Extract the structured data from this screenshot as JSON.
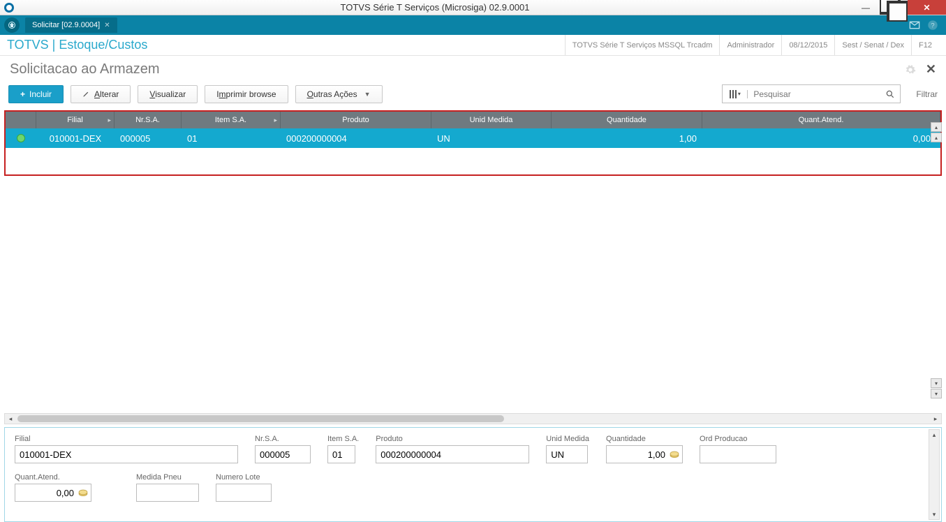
{
  "window": {
    "title": "TOTVS Série T Serviços (Microsiga) 02.9.0001"
  },
  "tab": {
    "label": "Solicitar [02.9.0004]"
  },
  "breadcrumb": "TOTVS | Estoque/Custos",
  "meta": {
    "env": "TOTVS Série T Serviços MSSQL Trcadm",
    "user": "Administrador",
    "date": "08/12/2015",
    "org": "Sest / Senat / Dex",
    "fkey": "F12"
  },
  "page_title": "Solicitacao ao Armazem",
  "toolbar": {
    "incluir": "Incluir",
    "alterar": "Alterar",
    "visualizar": "Visualizar",
    "imprimir": "Imprimir browse",
    "outras": "Outras Ações",
    "search_placeholder": "Pesquisar",
    "filtrar": "Filtrar"
  },
  "grid": {
    "headers": {
      "filial": "Filial",
      "nrsa": "Nr.S.A.",
      "itemsa": "Item S.A.",
      "produto": "Produto",
      "unid": "Unid Medida",
      "qtd": "Quantidade",
      "qatend": "Quant.Atend."
    },
    "row": {
      "filial": "010001-DEX",
      "nrsa": "000005",
      "itemsa": "01",
      "produto": "000200000004",
      "unid": "UN",
      "qtd": "1,00",
      "qatend": "0,00"
    }
  },
  "detail": {
    "labels": {
      "filial": "Filial",
      "nrsa": "Nr.S.A.",
      "itemsa": "Item S.A.",
      "produto": "Produto",
      "unid": "Unid Medida",
      "qtd": "Quantidade",
      "ordprod": "Ord Producao",
      "qatend": "Quant.Atend.",
      "medpneu": "Medida Pneu",
      "numlote": "Numero Lote"
    },
    "values": {
      "filial": "010001-DEX",
      "nrsa": "000005",
      "itemsa": "01",
      "produto": "000200000004",
      "unid": "UN",
      "qtd": "1,00",
      "ordprod": "",
      "qatend": "0,00",
      "medpneu": "",
      "numlote": ""
    }
  }
}
